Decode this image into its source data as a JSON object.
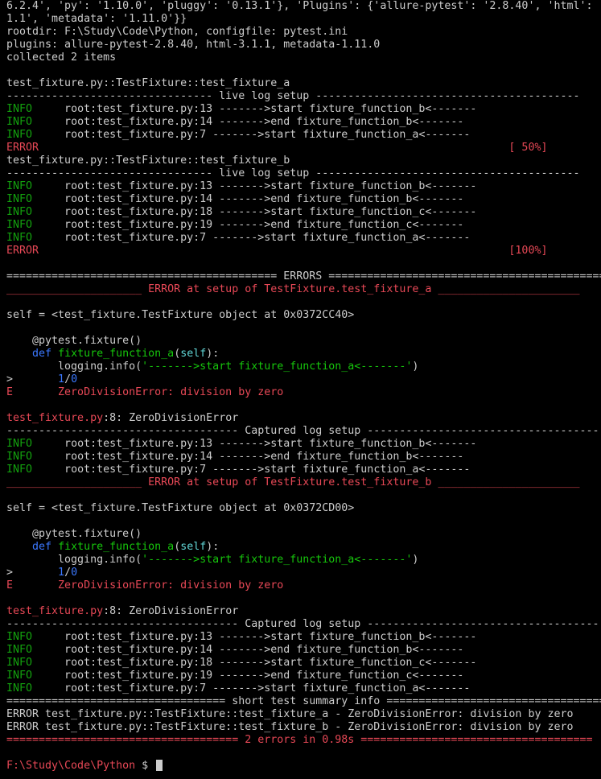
{
  "lines": [
    {
      "segments": [
        {
          "t": "6.2.4', 'py': '1.10.0', 'pluggy': '0.13.1'}, 'Plugins': {'allure-pytest': '2.8.40', 'html':"
        }
      ]
    },
    {
      "segments": [
        {
          "t": "1.1', 'metadata': '1.11.0'}}"
        }
      ]
    },
    {
      "segments": [
        {
          "t": "rootdir: F:\\Study\\Code\\Python, configfile: pytest.ini"
        }
      ]
    },
    {
      "segments": [
        {
          "t": "plugins: allure-pytest-2.8.40, html-3.1.1, metadata-1.11.0"
        }
      ]
    },
    {
      "segments": [
        {
          "t": "collected 2 items"
        }
      ]
    },
    {
      "segments": [
        {
          "t": ""
        }
      ]
    },
    {
      "segments": [
        {
          "t": "test_fixture.py::TestFixture::test_fixture_a"
        }
      ]
    },
    {
      "segments": [
        {
          "t": "-------------------------------- live log setup -----------------------------------------"
        }
      ]
    },
    {
      "segments": [
        {
          "t": "INFO",
          "c": "info"
        },
        {
          "t": "     root:test_fixture.py:13 ------->start fixture_function_b<-------"
        }
      ]
    },
    {
      "segments": [
        {
          "t": "INFO",
          "c": "info"
        },
        {
          "t": "     root:test_fixture.py:14 ------->end fixture_function_b<-------"
        }
      ]
    },
    {
      "segments": [
        {
          "t": "INFO",
          "c": "info"
        },
        {
          "t": "     root:test_fixture.py:7 ------->start fixture_function_a<-------"
        }
      ]
    },
    {
      "segments": [
        {
          "t": "ERROR",
          "c": "err"
        },
        {
          "t": "                                                                         [ 50%]",
          "c": "err"
        }
      ]
    },
    {
      "segments": [
        {
          "t": "test_fixture.py::TestFixture::test_fixture_b"
        }
      ]
    },
    {
      "segments": [
        {
          "t": "-------------------------------- live log setup -----------------------------------------"
        }
      ]
    },
    {
      "segments": [
        {
          "t": "INFO",
          "c": "info"
        },
        {
          "t": "     root:test_fixture.py:13 ------->start fixture_function_b<-------"
        }
      ]
    },
    {
      "segments": [
        {
          "t": "INFO",
          "c": "info"
        },
        {
          "t": "     root:test_fixture.py:14 ------->end fixture_function_b<-------"
        }
      ]
    },
    {
      "segments": [
        {
          "t": "INFO",
          "c": "info"
        },
        {
          "t": "     root:test_fixture.py:18 ------->start fixture_function_c<-------"
        }
      ]
    },
    {
      "segments": [
        {
          "t": "INFO",
          "c": "info"
        },
        {
          "t": "     root:test_fixture.py:19 ------->end fixture_function_c<-------"
        }
      ]
    },
    {
      "segments": [
        {
          "t": "INFO",
          "c": "info"
        },
        {
          "t": "     root:test_fixture.py:7 ------->start fixture_function_a<-------"
        }
      ]
    },
    {
      "segments": [
        {
          "t": "ERROR",
          "c": "err"
        },
        {
          "t": "                                                                         [100%]",
          "c": "err"
        }
      ]
    },
    {
      "segments": [
        {
          "t": ""
        }
      ]
    },
    {
      "segments": [
        {
          "t": "========================================== ERRORS ==========================================="
        }
      ]
    },
    {
      "segments": [
        {
          "t": "_____________________ ERROR at setup of TestFixture.test_fixture_a ______________________",
          "c": "err"
        }
      ]
    },
    {
      "segments": [
        {
          "t": ""
        }
      ]
    },
    {
      "segments": [
        {
          "t": "self = <test_fixture.TestFixture object at 0x0372CC40>"
        }
      ]
    },
    {
      "segments": [
        {
          "t": ""
        }
      ]
    },
    {
      "segments": [
        {
          "t": "    @pytest.fixture()"
        }
      ]
    },
    {
      "segments": [
        {
          "t": "    "
        },
        {
          "t": "def",
          "c": "blue"
        },
        {
          "t": " "
        },
        {
          "t": "fixture_function_a",
          "c": "green"
        },
        {
          "t": "("
        },
        {
          "t": "self",
          "c": "cyan"
        },
        {
          "t": "):"
        }
      ]
    },
    {
      "segments": [
        {
          "t": "        logging.info("
        },
        {
          "t": "'------->start fixture_function_a<-------'",
          "c": "green"
        },
        {
          "t": ")"
        }
      ]
    },
    {
      "segments": [
        {
          "t": ">       "
        },
        {
          "t": "1",
          "c": "blue"
        },
        {
          "t": "/"
        },
        {
          "t": "0",
          "c": "blue"
        }
      ]
    },
    {
      "segments": [
        {
          "t": "E       ZeroDivisionError: division by zero",
          "c": "err"
        }
      ]
    },
    {
      "segments": [
        {
          "t": ""
        }
      ]
    },
    {
      "segments": [
        {
          "t": "test_fixture.py",
          "c": "err"
        },
        {
          "t": ":8: ZeroDivisionError"
        }
      ]
    },
    {
      "segments": [
        {
          "t": "------------------------------------ Captured log setup ------------------------------------"
        }
      ]
    },
    {
      "segments": [
        {
          "t": "INFO",
          "c": "info"
        },
        {
          "t": "     root:test_fixture.py:13 ------->start fixture_function_b<-------"
        }
      ]
    },
    {
      "segments": [
        {
          "t": "INFO",
          "c": "info"
        },
        {
          "t": "     root:test_fixture.py:14 ------->end fixture_function_b<-------"
        }
      ]
    },
    {
      "segments": [
        {
          "t": "INFO",
          "c": "info"
        },
        {
          "t": "     root:test_fixture.py:7 ------->start fixture_function_a<-------"
        }
      ]
    },
    {
      "segments": [
        {
          "t": "_____________________ ERROR at setup of TestFixture.test_fixture_b ______________________",
          "c": "err"
        }
      ]
    },
    {
      "segments": [
        {
          "t": ""
        }
      ]
    },
    {
      "segments": [
        {
          "t": "self = <test_fixture.TestFixture object at 0x0372CD00>"
        }
      ]
    },
    {
      "segments": [
        {
          "t": ""
        }
      ]
    },
    {
      "segments": [
        {
          "t": "    @pytest.fixture()"
        }
      ]
    },
    {
      "segments": [
        {
          "t": "    "
        },
        {
          "t": "def",
          "c": "blue"
        },
        {
          "t": " "
        },
        {
          "t": "fixture_function_a",
          "c": "green"
        },
        {
          "t": "("
        },
        {
          "t": "self",
          "c": "cyan"
        },
        {
          "t": "):"
        }
      ]
    },
    {
      "segments": [
        {
          "t": "        logging.info("
        },
        {
          "t": "'------->start fixture_function_a<-------'",
          "c": "green"
        },
        {
          "t": ")"
        }
      ]
    },
    {
      "segments": [
        {
          "t": ">       "
        },
        {
          "t": "1",
          "c": "blue"
        },
        {
          "t": "/"
        },
        {
          "t": "0",
          "c": "blue"
        }
      ]
    },
    {
      "segments": [
        {
          "t": "E       ZeroDivisionError: division by zero",
          "c": "err"
        }
      ]
    },
    {
      "segments": [
        {
          "t": ""
        }
      ]
    },
    {
      "segments": [
        {
          "t": "test_fixture.py",
          "c": "err"
        },
        {
          "t": ":8: ZeroDivisionError"
        }
      ]
    },
    {
      "segments": [
        {
          "t": "------------------------------------ Captured log setup ------------------------------------"
        }
      ]
    },
    {
      "segments": [
        {
          "t": "INFO",
          "c": "info"
        },
        {
          "t": "     root:test_fixture.py:13 ------->start fixture_function_b<-------"
        }
      ]
    },
    {
      "segments": [
        {
          "t": "INFO",
          "c": "info"
        },
        {
          "t": "     root:test_fixture.py:14 ------->end fixture_function_b<-------"
        }
      ]
    },
    {
      "segments": [
        {
          "t": "INFO",
          "c": "info"
        },
        {
          "t": "     root:test_fixture.py:18 ------->start fixture_function_c<-------"
        }
      ]
    },
    {
      "segments": [
        {
          "t": "INFO",
          "c": "info"
        },
        {
          "t": "     root:test_fixture.py:19 ------->end fixture_function_c<-------"
        }
      ]
    },
    {
      "segments": [
        {
          "t": "INFO",
          "c": "info"
        },
        {
          "t": "     root:test_fixture.py:7 ------->start fixture_function_a<-------"
        }
      ]
    },
    {
      "segments": [
        {
          "t": "================================== short test summary info ==================================="
        }
      ]
    },
    {
      "segments": [
        {
          "t": "ERROR test_fixture.py::TestFixture::test_fixture_a - ZeroDivisionError: division by zero"
        }
      ]
    },
    {
      "segments": [
        {
          "t": "ERROR test_fixture.py::TestFixture::test_fixture_b - ZeroDivisionError: division by zero"
        }
      ]
    },
    {
      "segments": [
        {
          "t": "==================================== 2 errors in 0.98s ====================================",
          "c": "err"
        }
      ]
    },
    {
      "segments": [
        {
          "t": ""
        }
      ]
    },
    {
      "segments": [
        {
          "t": "F:\\Study\\Code\\Python",
          "c": "err"
        },
        {
          "t": " $ "
        }
      ]
    }
  ],
  "colors": {
    "background": "#000000",
    "text": "#cccccc",
    "info": "#13a10e",
    "error": "#e74856",
    "keyword": "#3b78ff",
    "function": "#16c60c",
    "self": "#61d6d6"
  }
}
